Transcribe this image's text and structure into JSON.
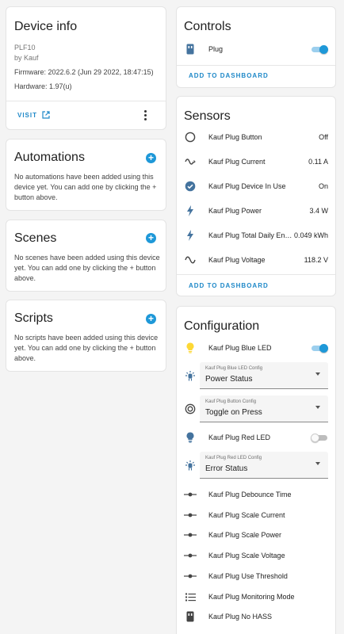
{
  "device_info": {
    "title": "Device info",
    "model": "PLF10",
    "manufacturer": "by Kauf",
    "firmware": "Firmware: 2022.6.2 (Jun 29 2022, 18:47:15)",
    "hardware": "Hardware: 1.97(u)",
    "visit_label": "VISIT"
  },
  "automations": {
    "title": "Automations",
    "text": "No automations have been added using this device yet. You can add one by clicking the + button above."
  },
  "scenes": {
    "title": "Scenes",
    "text": "No scenes have been added using this device yet. You can add one by clicking the + button above."
  },
  "scripts": {
    "title": "Scripts",
    "text": "No scripts have been added using this device yet. You can add one by clicking the + button above."
  },
  "controls": {
    "title": "Controls",
    "items": [
      {
        "label": "Plug",
        "icon": "plug-icon",
        "state": "on"
      }
    ],
    "add_label": "ADD TO DASHBOARD"
  },
  "sensors": {
    "title": "Sensors",
    "items": [
      {
        "label": "Kauf Plug Button",
        "value": "Off",
        "icon": "circle-outline-icon"
      },
      {
        "label": "Kauf Plug Current",
        "value": "0.11 A",
        "icon": "current-ac-icon"
      },
      {
        "label": "Kauf Plug Device In Use",
        "value": "On",
        "icon": "check-circle-icon"
      },
      {
        "label": "Kauf Plug Power",
        "value": "3.4 W",
        "icon": "flash-icon"
      },
      {
        "label": "Kauf Plug Total Daily En…",
        "value": "0.049 kWh",
        "icon": "flash-icon"
      },
      {
        "label": "Kauf Plug Voltage",
        "value": "118.2 V",
        "icon": "sine-wave-icon"
      }
    ],
    "add_label": "ADD TO DASHBOARD"
  },
  "configuration": {
    "title": "Configuration",
    "blue_led": {
      "label": "Kauf Plug Blue LED",
      "state": "on",
      "icon": "lightbulb-icon",
      "icon_color": "#fdd835"
    },
    "blue_led_config": {
      "label": "Kauf Plug Blue LED Config",
      "value": "Power Status",
      "icon": "led-config-icon"
    },
    "button_config": {
      "label": "Kauf Plug Button Config",
      "value": "Toggle on Press",
      "icon": "radiobox-icon"
    },
    "red_led": {
      "label": "Kauf Plug Red LED",
      "state": "off",
      "icon": "lightbulb-icon"
    },
    "red_led_config": {
      "label": "Kauf Plug Red LED Config",
      "value": "Error Status",
      "icon": "led-config-icon"
    },
    "numbers": [
      {
        "label": "Kauf Plug Debounce Time",
        "icon": "ray-vertex-icon"
      },
      {
        "label": "Kauf Plug Scale Current",
        "icon": "ray-vertex-icon"
      },
      {
        "label": "Kauf Plug Scale Power",
        "icon": "ray-vertex-icon"
      },
      {
        "label": "Kauf Plug Scale Voltage",
        "icon": "ray-vertex-icon"
      },
      {
        "label": "Kauf Plug Use Threshold",
        "icon": "ray-vertex-icon"
      }
    ],
    "monitoring": {
      "label": "Kauf Plug Monitoring Mode",
      "icon": "list-icon"
    },
    "no_hass": {
      "label": "Kauf Plug No HASS",
      "icon": "plug-icon"
    }
  },
  "colors": {
    "accent": "#1e98d8",
    "icon": "#44739e",
    "bulb_on": "#fdd835"
  }
}
